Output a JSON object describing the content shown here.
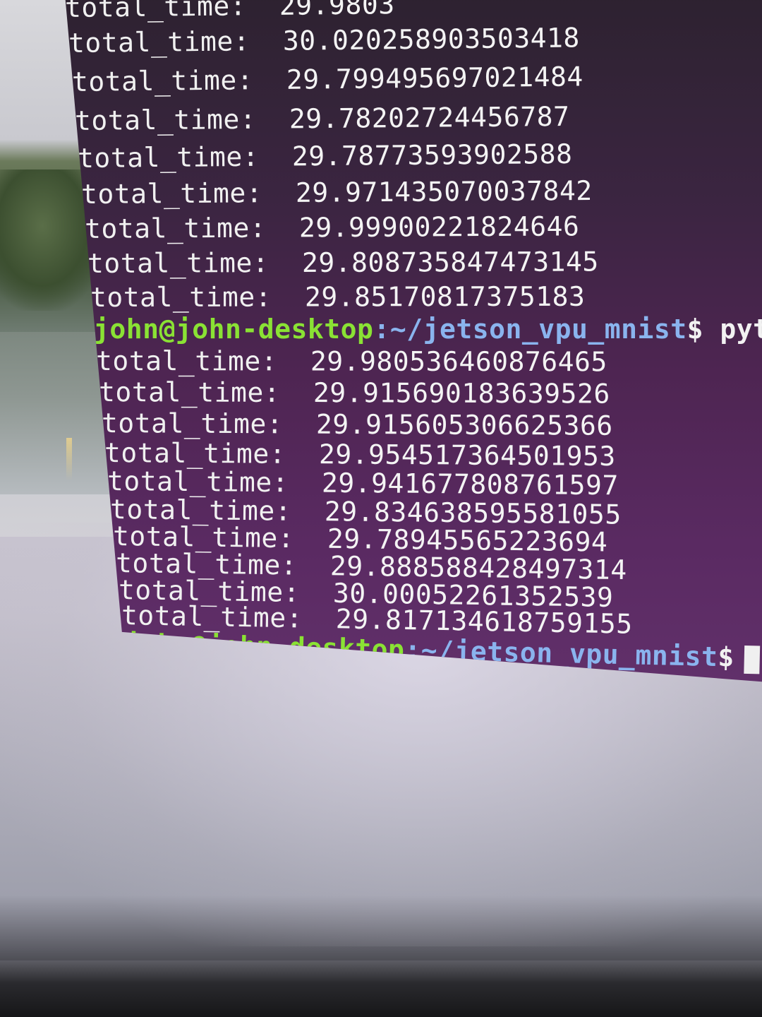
{
  "terminal": {
    "first_block": [
      {
        "label": "total_time:",
        "value": "29.9803"
      },
      {
        "label": "total_time:",
        "value": "30.020258903503418"
      },
      {
        "label": "total_time:",
        "value": "29.799495697021484"
      },
      {
        "label": "total_time:",
        "value": "29.78202724456787"
      },
      {
        "label": "total_time:",
        "value": "29.78773593902588"
      },
      {
        "label": "total_time:",
        "value": "29.971435070037842"
      },
      {
        "label": "total_time:",
        "value": "29.99900221824646"
      },
      {
        "label": "total_time:",
        "value": "29.808735847473145"
      },
      {
        "label": "total_time:",
        "value": "29.85170817375183"
      }
    ],
    "prompt1": {
      "user_host": "john@john-desktop",
      "path": ":~/jetson_vpu_mnist",
      "sign": "$",
      "command": " pyt"
    },
    "second_block": [
      {
        "label": "total_time:",
        "value": "29.980536460876465"
      },
      {
        "label": "total_time:",
        "value": "29.915690183639526"
      },
      {
        "label": "total_time:",
        "value": "29.915605306625366"
      },
      {
        "label": "total_time:",
        "value": "29.954517364501953"
      },
      {
        "label": "total_time:",
        "value": "29.941677808761597"
      },
      {
        "label": "total_time:",
        "value": "29.834638595581055"
      },
      {
        "label": "total_time:",
        "value": "29.78945565223694"
      },
      {
        "label": "total_time:",
        "value": "29.888588428497314"
      },
      {
        "label": "total_time:",
        "value": "30.00052261352539"
      },
      {
        "label": "total_time:",
        "value": "29.817134618759155"
      }
    ],
    "prompt2": {
      "user_host": "john@john-desktop",
      "path": ":~/jetson_vpu_mnist",
      "sign": "$"
    }
  },
  "colors": {
    "prompt_user": "#8ae234",
    "prompt_path": "#8ab4ee",
    "terminal_bg": "#4e2552"
  }
}
